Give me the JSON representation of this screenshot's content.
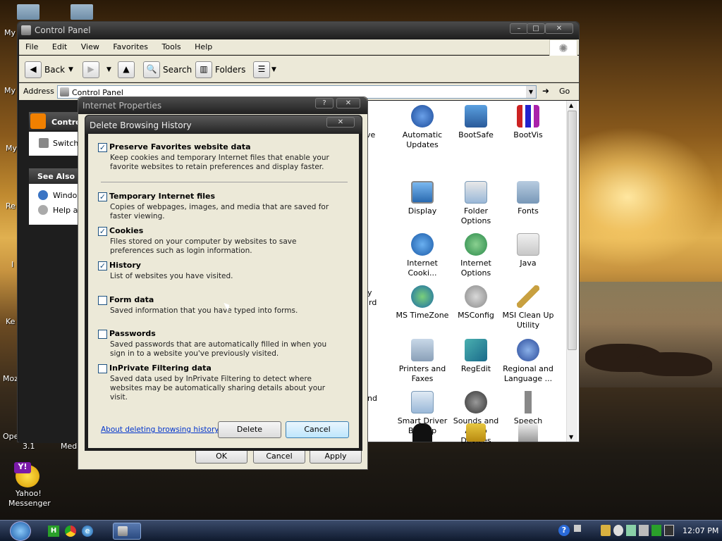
{
  "desktop": {
    "left_labels": [
      "My",
      "My",
      "My",
      "Re",
      "I",
      "Ke",
      "Moz",
      "Ope"
    ],
    "yahoo_label_1": "Yahoo!",
    "yahoo_label_2": "Messenger",
    "bottom_labels": [
      "3.1",
      "Medi"
    ]
  },
  "control_panel": {
    "title": "Control Panel",
    "menu": [
      "File",
      "Edit",
      "View",
      "Favorites",
      "Tools",
      "Help"
    ],
    "toolbar": {
      "back": "Back",
      "search": "Search",
      "folders": "Folders"
    },
    "address_label": "Address",
    "address_value": "Control Panel",
    "go": "Go",
    "sidebar": {
      "header": "Contro",
      "switch": "Switch",
      "see_also": "See Also",
      "links": [
        "Window",
        "Help an"
      ]
    },
    "partial_labels": [
      "ve",
      "y",
      "rd",
      "nd"
    ],
    "items": [
      {
        "label": "Automatic Updates",
        "icon": "automatic-updates-icon"
      },
      {
        "label": "BootSafe",
        "icon": "bootsafe-icon"
      },
      {
        "label": "BootVis",
        "icon": "bootvis-icon"
      },
      {
        "label": "Display",
        "icon": "display-icon"
      },
      {
        "label": "Folder Options",
        "icon": "folder-options-icon"
      },
      {
        "label": "Fonts",
        "icon": "fonts-icon"
      },
      {
        "label": "Internet Cooki...",
        "icon": "internet-cookies-icon"
      },
      {
        "label": "Internet Options",
        "icon": "internet-options-icon"
      },
      {
        "label": "Java",
        "icon": "java-icon"
      },
      {
        "label": "MS TimeZone",
        "icon": "timezone-icon"
      },
      {
        "label": "MSConfig",
        "icon": "msconfig-icon"
      },
      {
        "label": "MSI Clean Up Utility",
        "icon": "msi-cleanup-icon"
      },
      {
        "label": "Printers and Faxes",
        "icon": "printers-icon"
      },
      {
        "label": "RegEdit",
        "icon": "regedit-icon"
      },
      {
        "label": "Regional and Language ...",
        "icon": "regional-icon"
      },
      {
        "label": "Smart Driver Backup",
        "icon": "smart-driver-icon"
      },
      {
        "label": "Sounds and Audio Devices",
        "icon": "sounds-icon"
      },
      {
        "label": "Speech",
        "icon": "speech-icon"
      }
    ]
  },
  "internet_properties": {
    "title": "Internet Properties",
    "help": "?",
    "ok": "OK",
    "cancel": "Cancel",
    "apply": "Apply"
  },
  "delete_dialog": {
    "title": "Delete Browsing History",
    "options": [
      {
        "title": "Preserve Favorites website data",
        "checked": true,
        "description": "Keep cookies and temporary Internet files that enable your favorite websites to retain preferences and display faster."
      },
      {
        "title": "Temporary Internet files",
        "checked": true,
        "description": "Copies of webpages, images, and media that are saved for faster viewing."
      },
      {
        "title": "Cookies",
        "checked": true,
        "description": "Files stored on your computer by websites to save preferences such as login information."
      },
      {
        "title": "History",
        "checked": true,
        "description": "List of websites you have visited."
      },
      {
        "title": "Form data",
        "checked": false,
        "description": "Saved information that you have typed into forms."
      },
      {
        "title": "Passwords",
        "checked": false,
        "description": "Saved passwords that are automatically filled in when you sign in to a website you've previously visited."
      },
      {
        "title": "InPrivate Filtering data",
        "checked": false,
        "description": "Saved data used by InPrivate Filtering to detect where websites may be automatically sharing details about your visit."
      }
    ],
    "about_link": "About deleting browsing history",
    "delete": "Delete",
    "cancel": "Cancel"
  },
  "taskbar": {
    "clock": "12:07 PM"
  },
  "colors": {
    "accent": "#1c5180",
    "link": "#0033cc"
  }
}
